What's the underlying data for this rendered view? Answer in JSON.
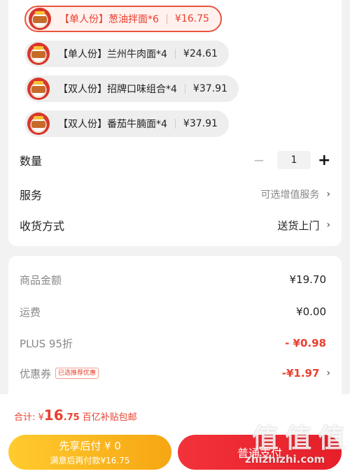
{
  "variants": [
    {
      "label": "【单人份】葱油拌面*6",
      "price": "¥16.75",
      "selected": true
    },
    {
      "label": "【单人份】兰州牛肉面*4",
      "price": "¥24.61",
      "selected": false
    },
    {
      "label": "【双人份】招牌口味组合*4",
      "price": "¥37.91",
      "selected": false
    },
    {
      "label": "【双人份】番茄牛腩面*4",
      "price": "¥37.91",
      "selected": false
    }
  ],
  "quantity": {
    "label": "数量",
    "minus": "−",
    "value": "1",
    "plus": "+"
  },
  "service": {
    "label": "服务",
    "value": "可选增值服务",
    "chevron": "›"
  },
  "delivery": {
    "label": "收货方式",
    "value": "送货上门",
    "chevron": "›"
  },
  "fees": {
    "goods": {
      "label": "商品金额",
      "value": "¥19.70"
    },
    "shipping": {
      "label": "运费",
      "value": "¥0.00"
    },
    "plus": {
      "label": "PLUS 95折",
      "value": "- ¥0.98"
    },
    "coupon": {
      "label": "优惠券",
      "badge": "已选推荐优惠",
      "value": "-¥1.97",
      "chevron": "›"
    }
  },
  "bottom": {
    "total_label": "合计: ¥",
    "total_int": "16",
    "total_dec": ".75",
    "total_note": "百亿补贴包邮",
    "pay_later_line1": "先享后付 ¥ 0",
    "pay_later_line2": "满意后再付款¥16.75",
    "normal_pay": "普通支付"
  },
  "watermark": {
    "glyphs": "值 值 值",
    "site": "zhizhizhi.com"
  },
  "colors": {
    "accent": "#e9402f",
    "pay_later": "#f6a613",
    "normal_pay": "#e61f2a"
  }
}
